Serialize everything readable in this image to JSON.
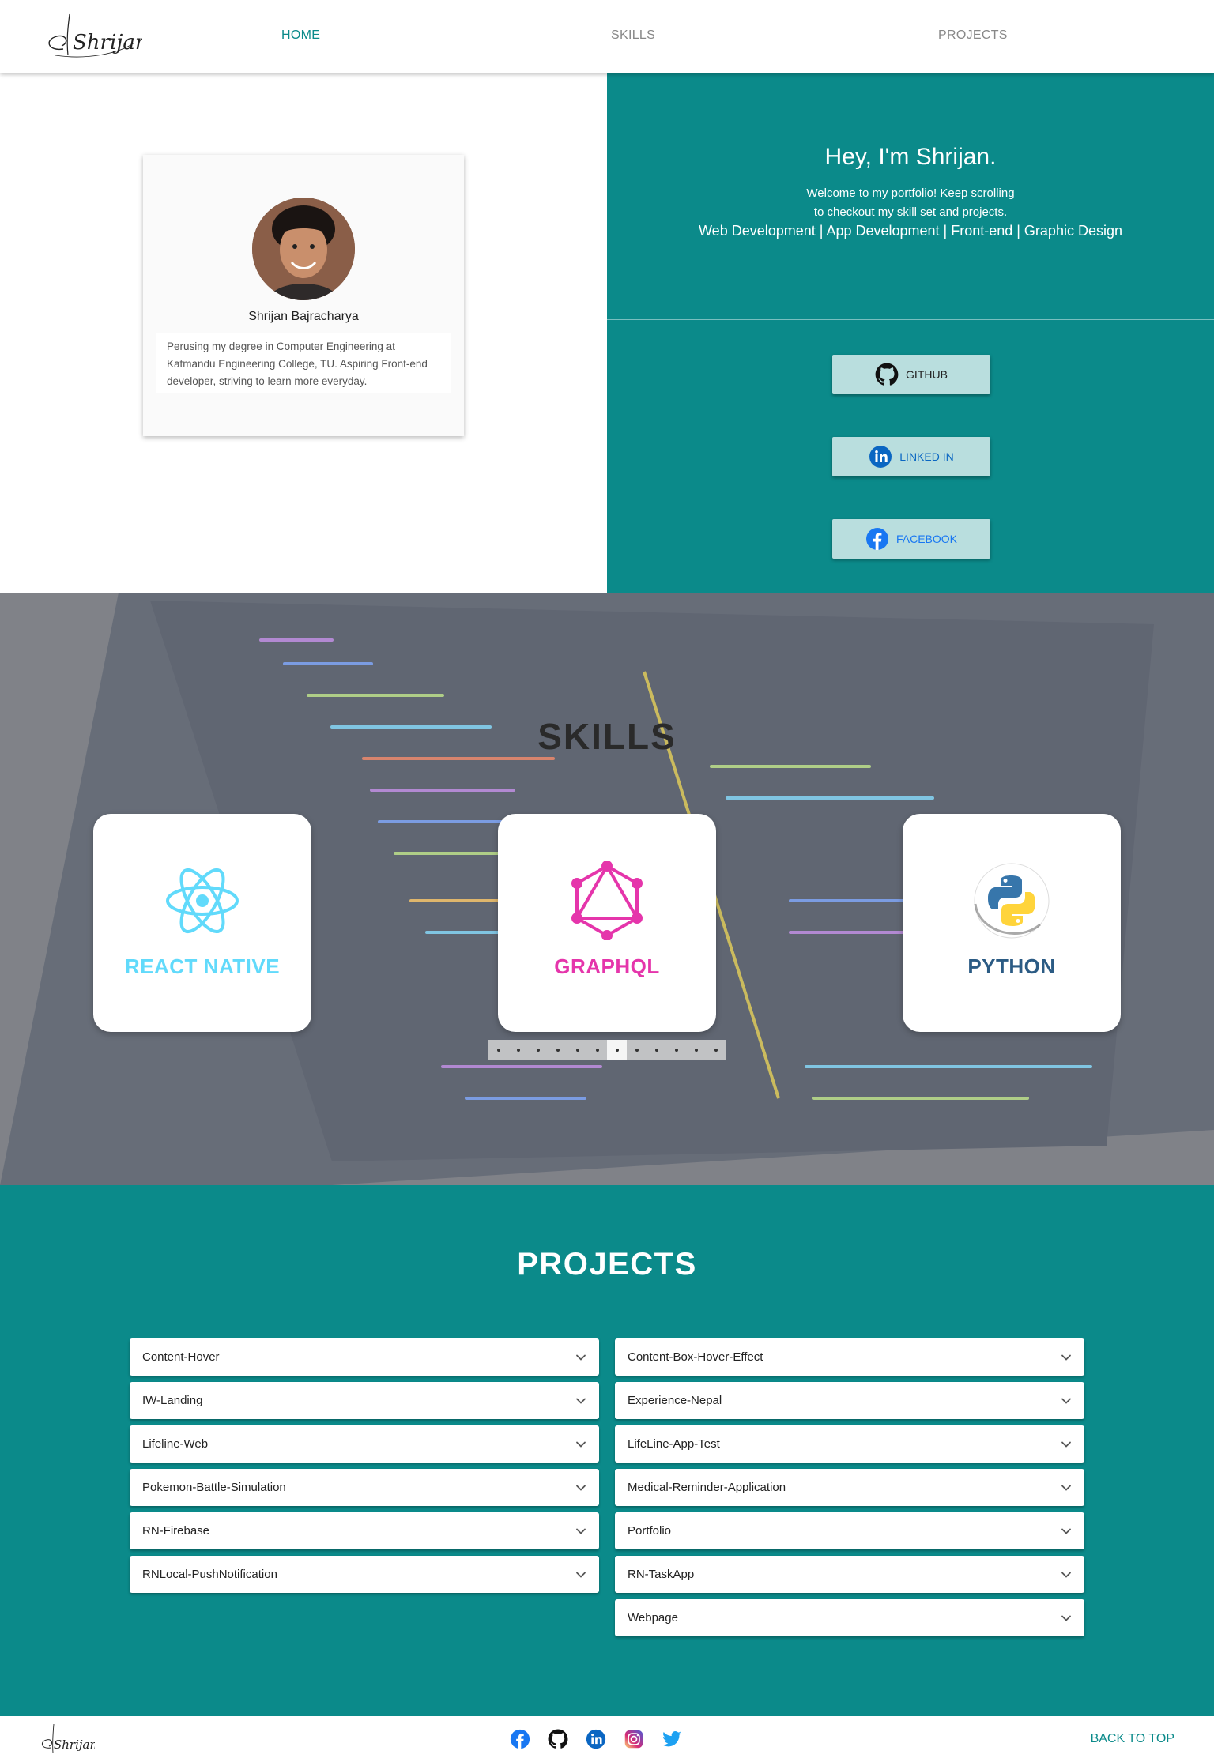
{
  "nav": {
    "logo_text": "Shrijan",
    "links": [
      {
        "label": "HOME",
        "active": true
      },
      {
        "label": "SKILLS",
        "active": false
      },
      {
        "label": "PROJECTS",
        "active": false
      }
    ]
  },
  "profile": {
    "name": "Shrijan Bajracharya",
    "bio": "Perusing my degree in Computer Engineering at Katmandu Engineering College, TU. Aspiring Front-end developer, striving to learn more everyday."
  },
  "hero": {
    "title": "Hey, I'm Shrijan.",
    "welcome_line1": "Welcome to my portfolio! Keep scrolling",
    "welcome_line2": "to checkout my skill set and projects.",
    "roles": "Web Development | App Development | Front-end | Graphic Design"
  },
  "social_buttons": [
    {
      "label": "GITHUB",
      "icon": "github-icon",
      "color": "#222222"
    },
    {
      "label": "LINKED IN",
      "icon": "linkedin-icon",
      "color": "#0a66c2"
    },
    {
      "label": "FACEBOOK",
      "icon": "facebook-icon",
      "color": "#1877f2"
    }
  ],
  "skills": {
    "title": "SKILLS",
    "cards": [
      {
        "label": "REACT NATIVE",
        "icon": "react-icon",
        "color": "#61dafb"
      },
      {
        "label": "GRAPHQL",
        "icon": "graphql-icon",
        "color": "#e535ab"
      },
      {
        "label": "PYTHON",
        "icon": "python-icon",
        "color": "#2b5b84"
      }
    ],
    "carousel_pages": 12,
    "carousel_active": 6
  },
  "projects": {
    "title": "PROJECTS",
    "left": [
      "Content-Hover",
      "IW-Landing",
      "Lifeline-Web",
      "Pokemon-Battle-Simulation",
      "RN-Firebase",
      "RNLocal-PushNotification"
    ],
    "right": [
      "Content-Box-Hover-Effect",
      "Experience-Nepal",
      "LifeLine-App-Test",
      "Medical-Reminder-Application",
      "Portfolio",
      "RN-TaskApp",
      "Webpage"
    ]
  },
  "footer": {
    "logo_text": "Shrijan",
    "icons": [
      "facebook-icon",
      "github-icon",
      "linkedin-icon",
      "instagram-icon",
      "twitter-icon"
    ],
    "back_to_top": "BACK TO TOP"
  },
  "colors": {
    "accent": "#0b8a8a",
    "button_bg": "#b9dede"
  }
}
